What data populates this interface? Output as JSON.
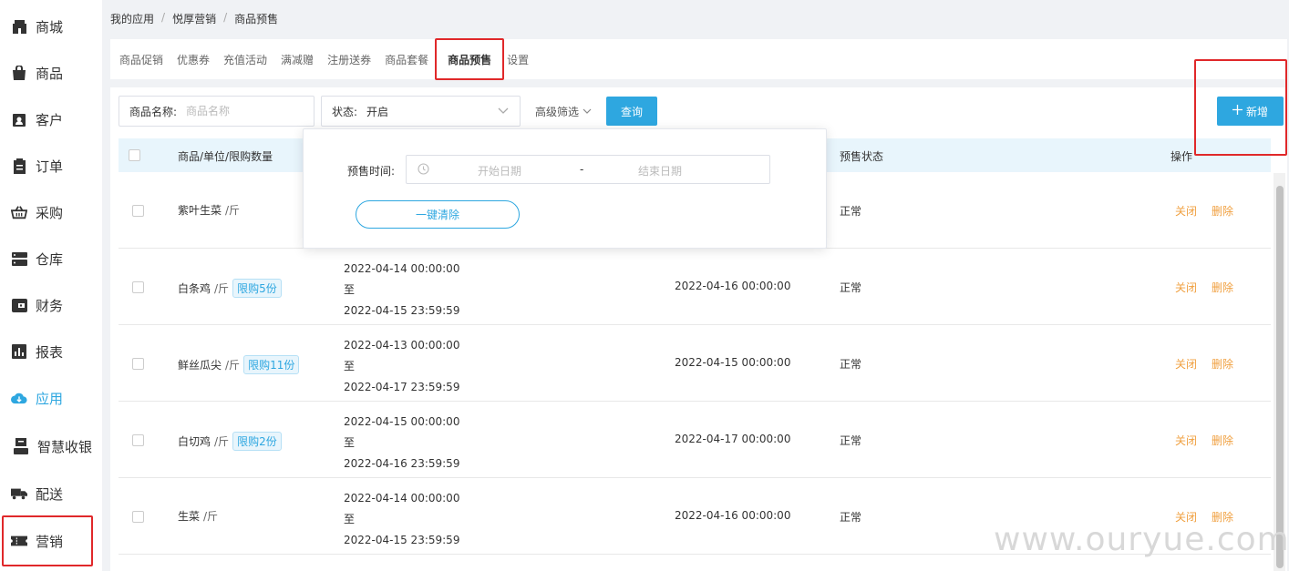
{
  "sidebar": {
    "items": [
      {
        "label": "商城",
        "icon": "store-icon"
      },
      {
        "label": "商品",
        "icon": "bag-icon"
      },
      {
        "label": "客户",
        "icon": "id-card-icon"
      },
      {
        "label": "订单",
        "icon": "clipboard-icon"
      },
      {
        "label": "采购",
        "icon": "basket-icon"
      },
      {
        "label": "仓库",
        "icon": "server-icon"
      },
      {
        "label": "财务",
        "icon": "wallet-icon"
      },
      {
        "label": "报表",
        "icon": "bar-chart-icon"
      },
      {
        "label": "应用",
        "icon": "cloud-download-icon"
      },
      {
        "label": "智慧收银",
        "icon": "cashier-icon"
      },
      {
        "label": "配送",
        "icon": "truck-icon"
      },
      {
        "label": "营销",
        "icon": "ticket-icon"
      }
    ],
    "active_color": "#2ea7e0"
  },
  "breadcrumb": [
    "我的应用",
    "悦厚营销",
    "商品预售"
  ],
  "tabs": [
    "商品促销",
    "优惠券",
    "充值活动",
    "满减赠",
    "注册送券",
    "商品套餐",
    "商品预售",
    "设置"
  ],
  "filters": {
    "name_label": "商品名称:",
    "name_placeholder": "商品名称",
    "status_label": "状态:",
    "status_value": "开启",
    "advanced_label": "高级筛选",
    "query_button": "查询",
    "new_button": "新增"
  },
  "table": {
    "col_product": "商品/单位/限购数量",
    "col_state": "预售状态",
    "col_ops": "操作",
    "rows": [
      {
        "name": "紫叶生菜",
        "unit": "/斤",
        "limit": "",
        "period_start": "",
        "period_to": "",
        "period_end": "",
        "ship": "",
        "state": "正常",
        "op_close": "关闭",
        "op_delete": "删除"
      },
      {
        "name": "白条鸡",
        "unit": "/斤",
        "limit": "限购5份",
        "period_start": "2022-04-14 00:00:00",
        "period_to": "至",
        "period_end": "2022-04-15 23:59:59",
        "ship": "2022-04-16 00:00:00",
        "state": "正常",
        "op_close": "关闭",
        "op_delete": "删除"
      },
      {
        "name": "鲜丝瓜尖",
        "unit": "/斤",
        "limit": "限购11份",
        "period_start": "2022-04-13 00:00:00",
        "period_to": "至",
        "period_end": "2022-04-17 23:59:59",
        "ship": "2022-04-15 00:00:00",
        "state": "正常",
        "op_close": "关闭",
        "op_delete": "删除"
      },
      {
        "name": "白切鸡",
        "unit": "/斤",
        "limit": "限购2份",
        "period_start": "2022-04-15 00:00:00",
        "period_to": "至",
        "period_end": "2022-04-16 23:59:59",
        "ship": "2022-04-17 00:00:00",
        "state": "正常",
        "op_close": "关闭",
        "op_delete": "删除"
      },
      {
        "name": "生菜",
        "unit": "/斤",
        "limit": "",
        "period_start": "2022-04-14 00:00:00",
        "period_to": "至",
        "period_end": "2022-04-15 23:59:59",
        "ship": "2022-04-16 00:00:00",
        "state": "正常",
        "op_close": "关闭",
        "op_delete": "删除"
      }
    ]
  },
  "popover": {
    "label": "预售时间:",
    "start_placeholder": "开始日期",
    "separator": "-",
    "end_placeholder": "结束日期",
    "clear_button": "一键清除"
  },
  "watermark": "www.ouryue.com"
}
